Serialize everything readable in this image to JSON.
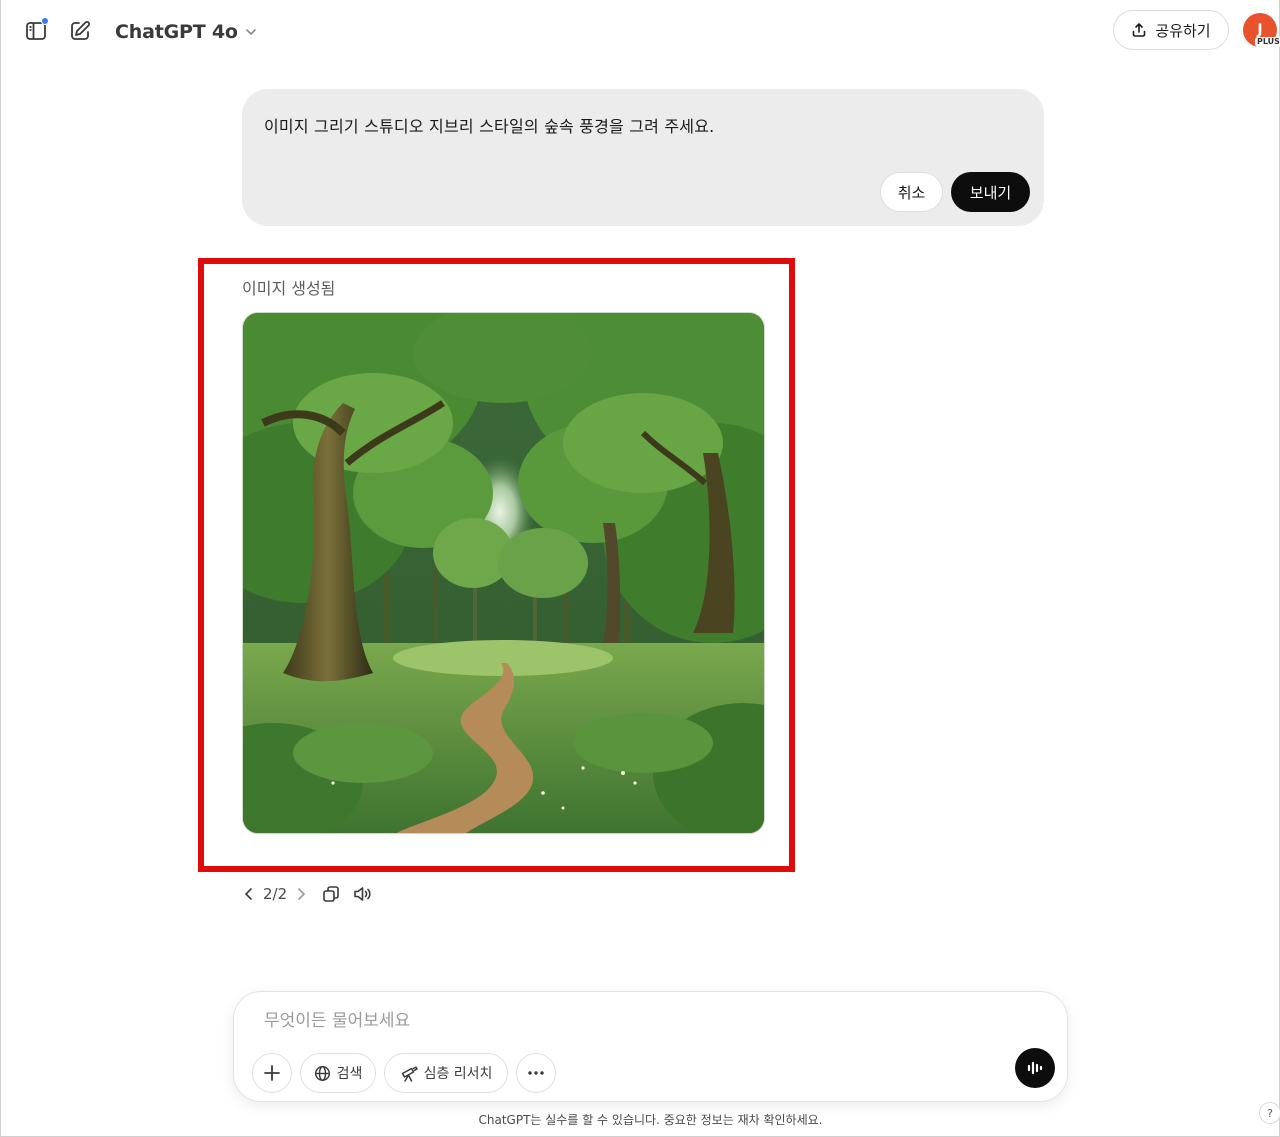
{
  "header": {
    "model_name": "ChatGPT 4o",
    "share_label": "공유하기",
    "avatar_initial": "J",
    "plan_badge": "PLUS"
  },
  "edit_message": {
    "text": "이미지 그리기 스튜디오 지브리 스타일의 숲속 풍경을 그려 주세요.",
    "cancel_label": "취소",
    "send_label": "보내기"
  },
  "assistant": {
    "image_status": "이미지 생성됨",
    "image_alt": "숲속 풍경",
    "pager": "2/2"
  },
  "composer": {
    "placeholder": "무엇이든 물어보세요",
    "value": "",
    "search_label": "검색",
    "research_label": "심층 리서치"
  },
  "footer": {
    "disclaimer": "ChatGPT는 실수를 할 수 있습니다. 중요한 정보는 재차 확인하세요.",
    "help_label": "?"
  },
  "colors": {
    "highlight": "#e00b0b",
    "avatar": "#e8522d",
    "notification": "#2f7af7",
    "send_button": "#0d0d0d"
  },
  "icons": [
    "sidebar-toggle-icon",
    "new-chat-icon",
    "chevron-down-icon",
    "share-upload-icon",
    "chevron-left-icon",
    "chevron-right-icon",
    "copy-icon",
    "speaker-icon",
    "plus-icon",
    "globe-icon",
    "telescope-icon",
    "more-dots-icon",
    "voice-waveform-icon"
  ]
}
